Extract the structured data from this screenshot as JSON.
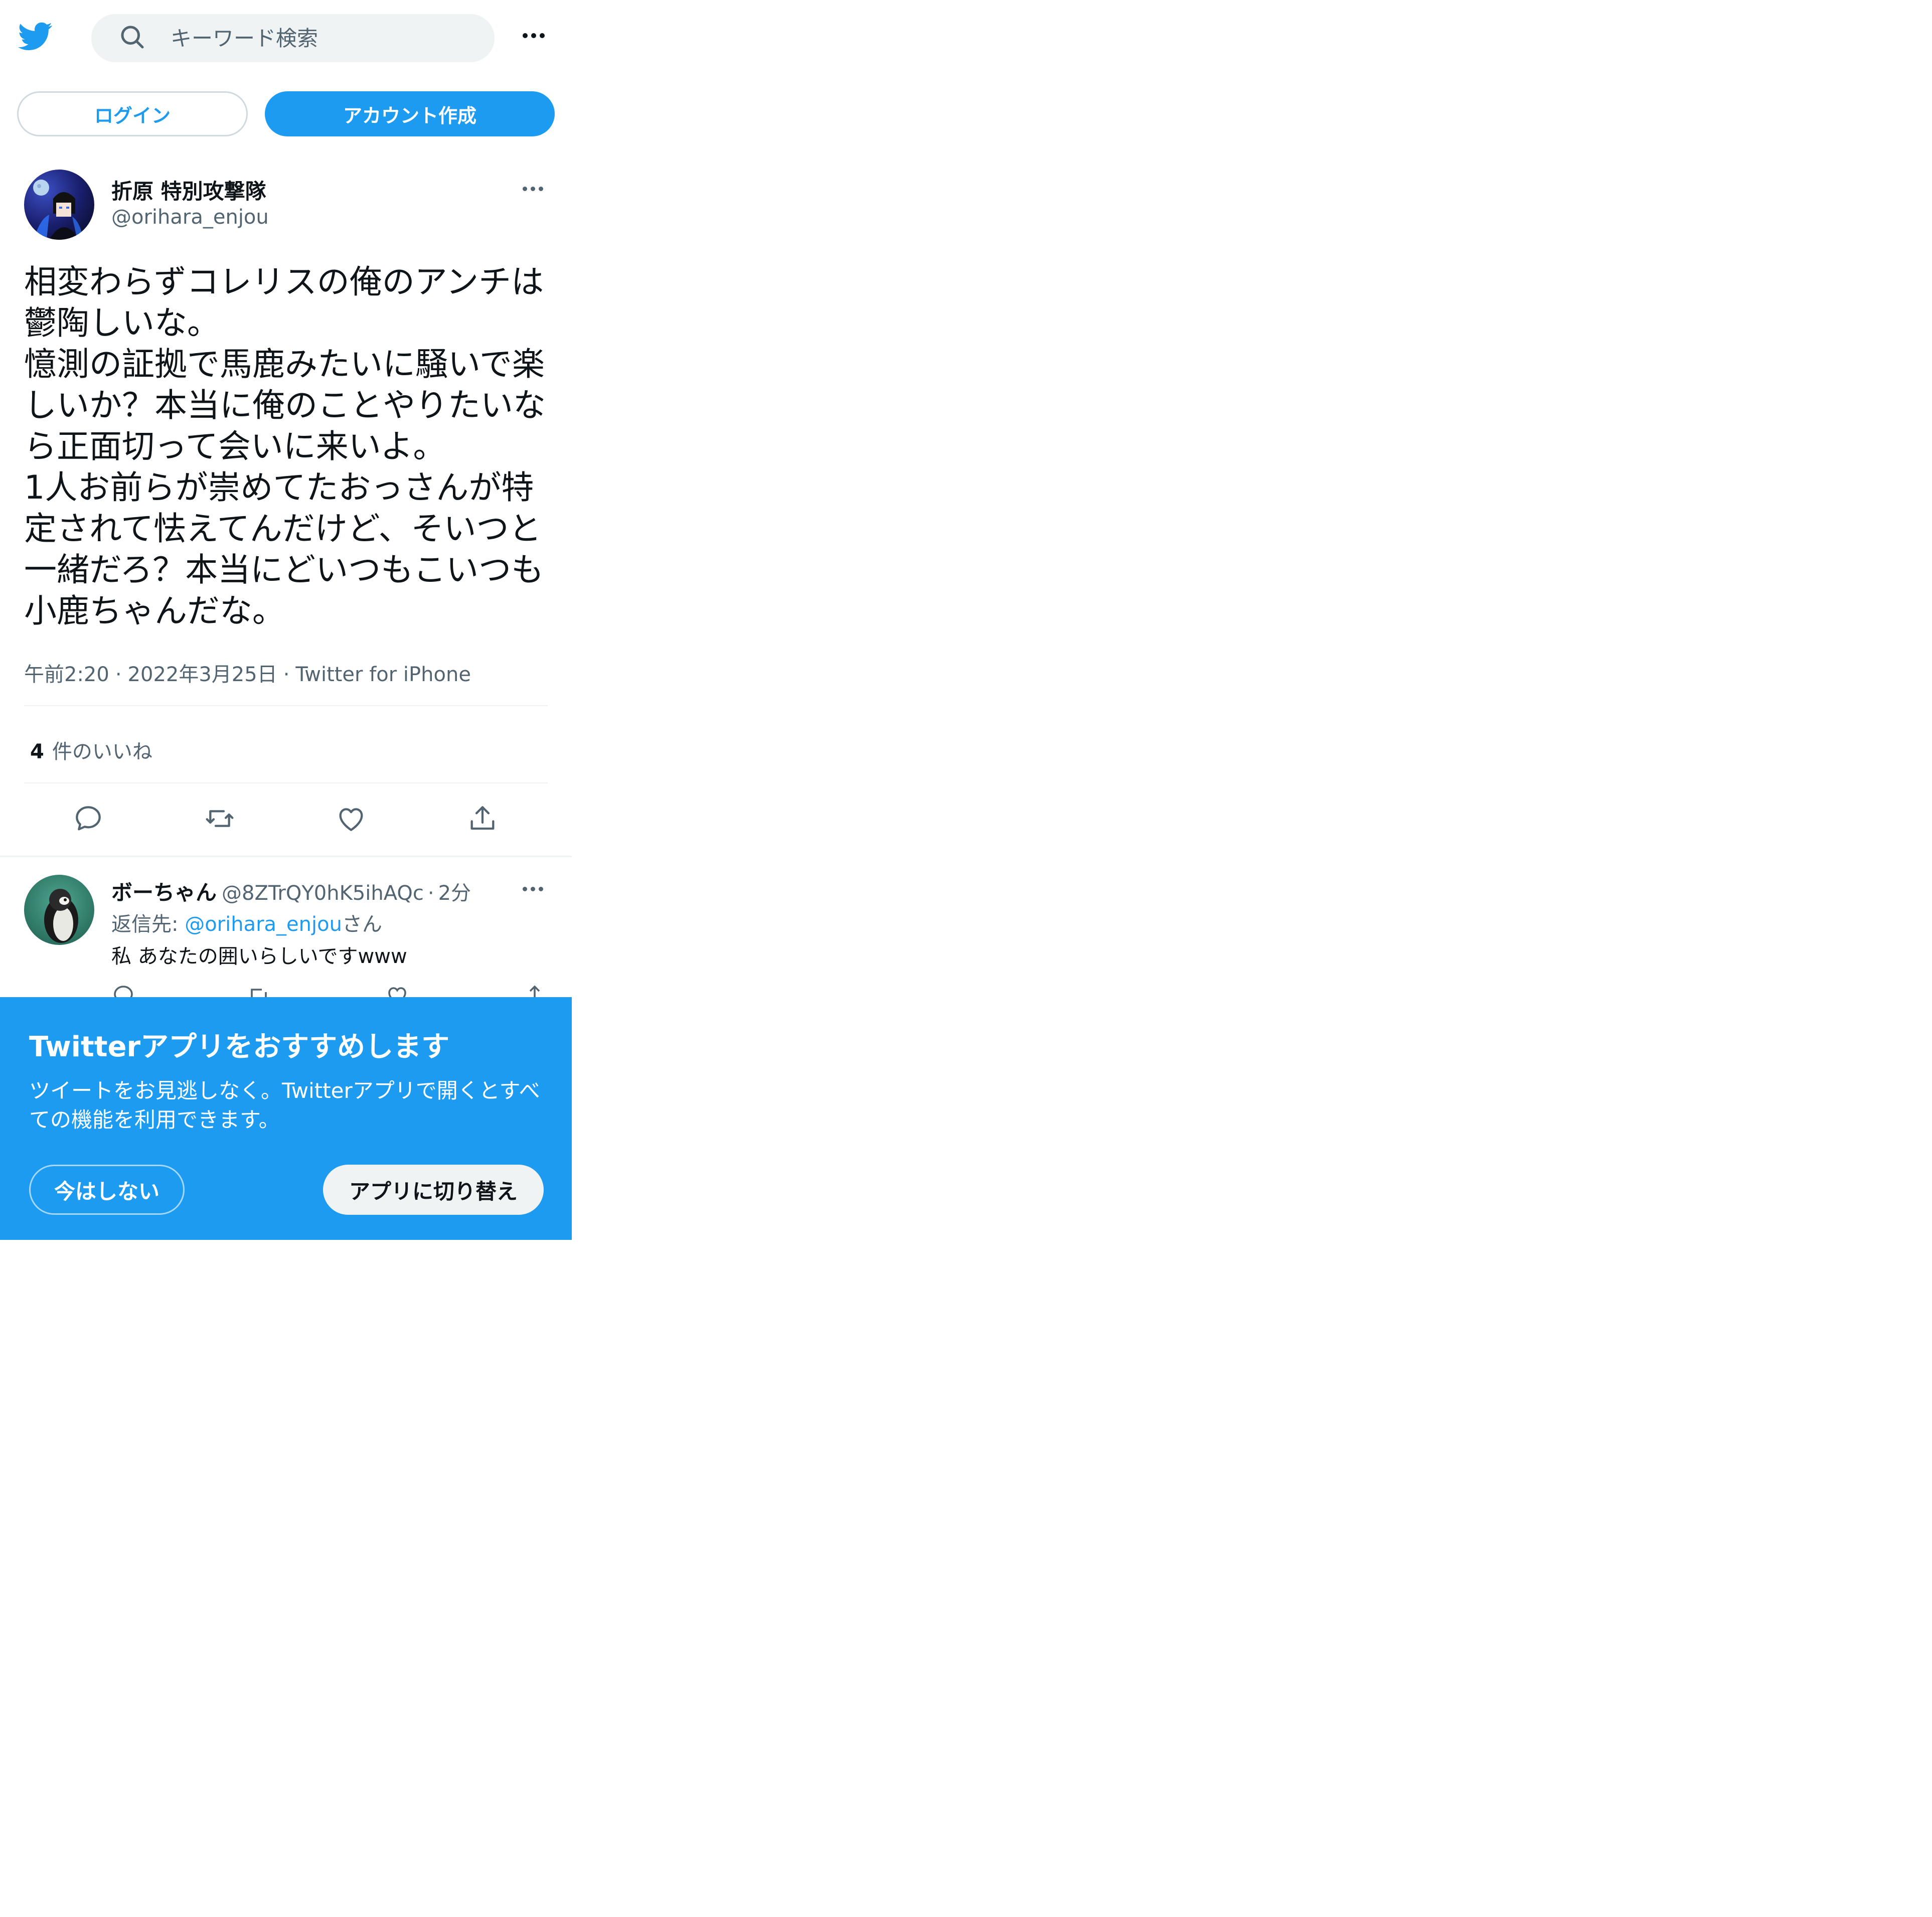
{
  "header": {
    "search_placeholder": "キーワード検索"
  },
  "auth": {
    "login_label": "ログイン",
    "signup_label": "アカウント作成"
  },
  "tweet": {
    "display_name": "折原 特別攻撃隊",
    "handle": "@orihara_enjou",
    "text": "相変わらずコレリスの俺のアンチは鬱陶しいな。\n憶測の証拠で馬鹿みたいに騒いで楽しいか？本当に俺のことやりたいなら正面切って会いに来いよ。\n1人お前らが崇めてたおっさんが特定されて怯えてんだけど、そいつと一緒だろ？本当にどいつもこいつも小鹿ちゃんだな。",
    "time": "午前2:20",
    "date": "2022年3月25日",
    "source": "Twitter for iPhone",
    "separator": "·",
    "likes_count": "4",
    "likes_label": "件のいいね"
  },
  "reply": {
    "display_name": "ボーちゃん",
    "handle": "@8ZTrQY0hK5ihAQc",
    "separator": "·",
    "time_ago": "2分",
    "reply_to_prefix": "返信先: ",
    "reply_to_handle": "@orihara_enjou",
    "reply_to_suffix": "さん",
    "text": "私 あなたの囲いらしいですwww"
  },
  "app_banner": {
    "title": "Twitterアプリをおすすめします",
    "body": "ツイートをお見逃しなく。Twitterアプリで開くとすべての機能を利用できます。",
    "not_now_label": "今はしない",
    "switch_label": "アプリに切り替え"
  },
  "colors": {
    "brand_blue": "#1d9bf0",
    "text_primary": "#0f1419",
    "text_secondary": "#536471",
    "divider": "#eff3f4"
  },
  "icons": {
    "logo": "twitter-bird-icon",
    "search": "search-icon",
    "more": "more-dots-icon",
    "reply": "reply-icon",
    "retweet": "retweet-icon",
    "like": "heart-icon",
    "share": "share-icon"
  }
}
